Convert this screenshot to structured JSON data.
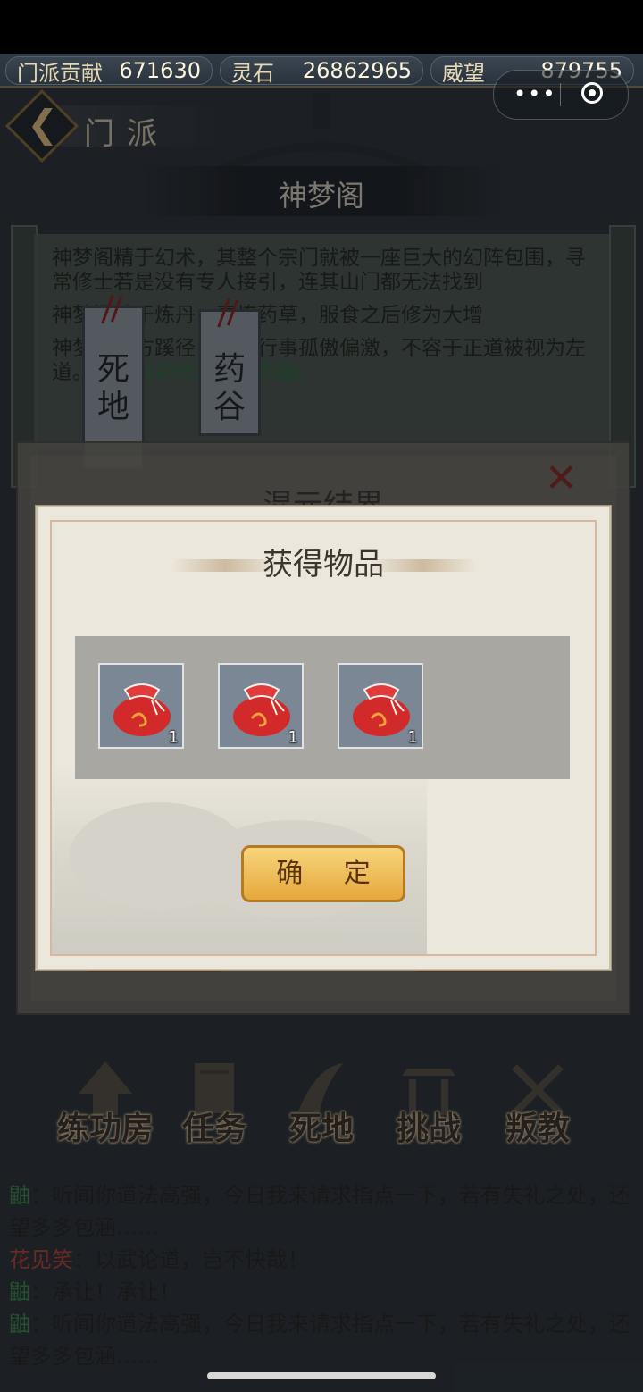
{
  "resources": [
    {
      "label": "门派贡献",
      "value": "671630"
    },
    {
      "label": "灵石",
      "value": "26862965"
    },
    {
      "label": "威望",
      "value": "879755"
    }
  ],
  "capsule": {
    "more_icon": "more-dots-icon",
    "close_icon": "target-icon"
  },
  "header": {
    "back_label": "门派"
  },
  "sect": {
    "name": "神梦阁",
    "description_lines": [
      "神梦阁精于幻术，其整个宗门就被一座巨大的幻阵包围，寻常修士若是没有专人接引，连其山门都无法找到",
      "神梦阁精于炼丹，烹炼药草，服食之后修为大增",
      "神梦阁炼方蹊径，门人行事孤傲偏激，不容于正道被视为左道。"
    ],
    "description_green": "门派当前代理掌门为鼬。",
    "tags": [
      "死地",
      "药谷"
    ]
  },
  "behind_dialog": {
    "title": "混元结界"
  },
  "dialog": {
    "title": "获得物品",
    "items": [
      {
        "name": "red-pouch",
        "count": "1"
      },
      {
        "name": "red-pouch",
        "count": "1"
      },
      {
        "name": "red-pouch",
        "count": "1"
      }
    ],
    "confirm_label": "确 定"
  },
  "nav": [
    "练功房",
    "任务",
    "死地",
    "挑战",
    "叛教"
  ],
  "log": [
    {
      "speaker": "鼬",
      "color": "green",
      "text": "：听闻你道法高强，今日我来请求指点一下，若有失礼之处，还望多多包涵……"
    },
    {
      "speaker": "花见笑",
      "color": "red",
      "text": "：以武论道，岂不快哉！"
    },
    {
      "speaker": "鼬",
      "color": "green",
      "text": "：承让！承让！"
    },
    {
      "speaker": "鼬",
      "color": "green",
      "text": "：听闻你道法高强，今日我来请求指点一下，若有失礼之处，还望多多包涵……"
    }
  ],
  "colors": {
    "accent_gold": "#e6a83c",
    "name_green": "#3b8b4f",
    "name_red": "#b2443a"
  }
}
